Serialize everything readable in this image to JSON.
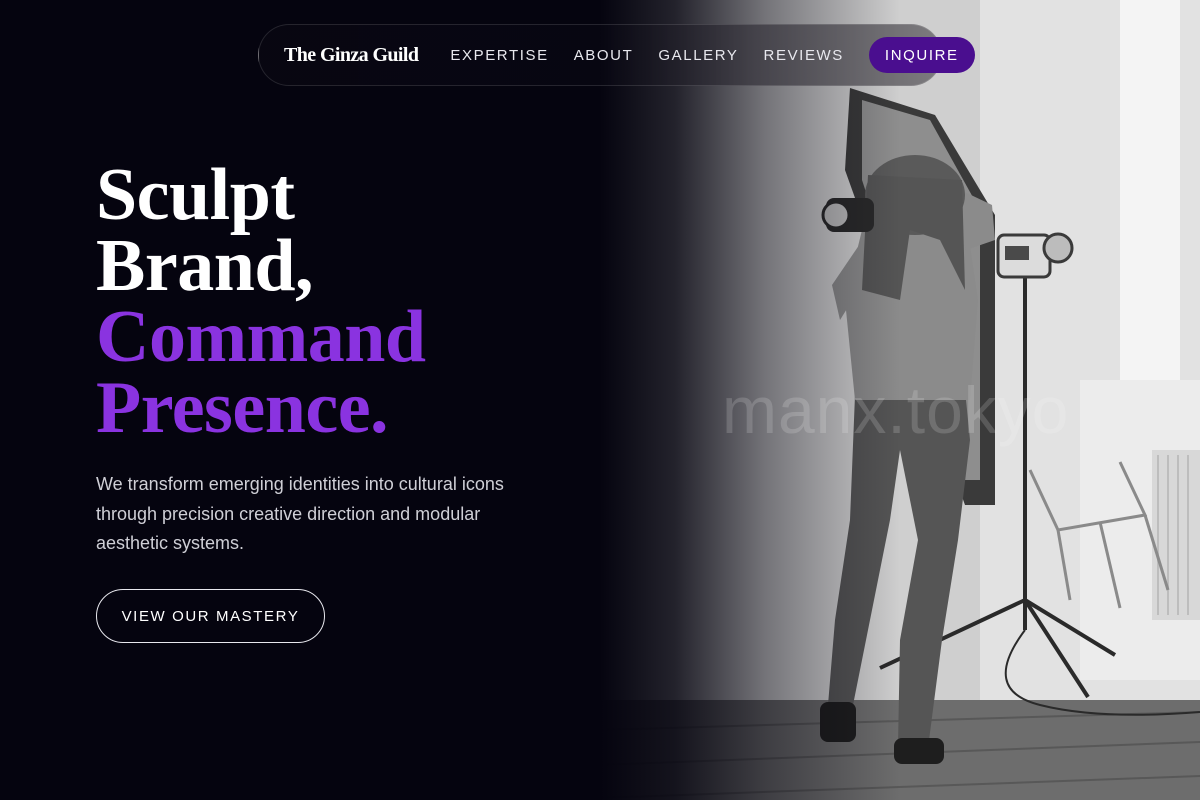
{
  "nav": {
    "brand": "The Ginza Guild",
    "links": [
      "EXPERTISE",
      "ABOUT",
      "GALLERY",
      "REVIEWS"
    ],
    "cta": "INQUIRE"
  },
  "hero": {
    "headline_white": [
      "Sculpt",
      "Brand,"
    ],
    "headline_accent": [
      "Command",
      "Presence."
    ],
    "subcopy": "We transform emerging identities into cultural icons through precision creative direction and modular aesthetic systems.",
    "cta": "VIEW OUR MASTERY"
  },
  "image": {
    "description_icon": "photographer-photo",
    "watermark": "manx.tokyo"
  },
  "colors": {
    "background": "#05040f",
    "accent": "#8a33e0",
    "cta_fill": "#4a0e8f"
  }
}
